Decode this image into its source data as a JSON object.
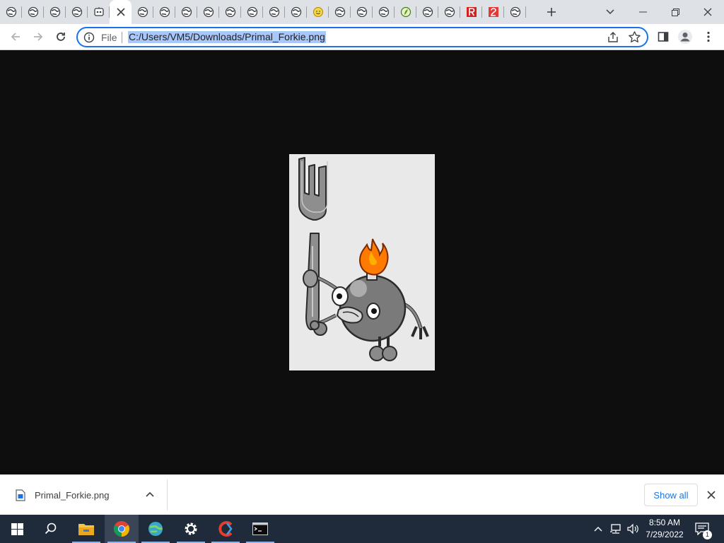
{
  "browser": {
    "tabs": [
      {
        "favicon": "globe-icon",
        "active": false
      },
      {
        "favicon": "globe-icon",
        "active": false
      },
      {
        "favicon": "globe-icon",
        "active": false
      },
      {
        "favicon": "globe-icon",
        "active": false
      },
      {
        "favicon": "robot-icon",
        "active": false
      },
      {
        "favicon": "close-icon",
        "active": true
      },
      {
        "favicon": "globe-icon",
        "active": false
      },
      {
        "favicon": "globe-icon",
        "active": false
      },
      {
        "favicon": "globe-icon",
        "active": false
      },
      {
        "favicon": "globe-icon",
        "active": false
      },
      {
        "favicon": "globe-icon",
        "active": false
      },
      {
        "favicon": "globe-icon",
        "active": false
      },
      {
        "favicon": "globe-icon",
        "active": false
      },
      {
        "favicon": "globe-icon",
        "active": false
      },
      {
        "favicon": "smiley-icon",
        "active": false
      },
      {
        "favicon": "globe-icon",
        "active": false
      },
      {
        "favicon": "globe-icon",
        "active": false
      },
      {
        "favicon": "globe-icon",
        "active": false
      },
      {
        "favicon": "green-leaf-icon",
        "active": false
      },
      {
        "favicon": "globe-icon",
        "active": false
      },
      {
        "favicon": "globe-icon",
        "active": false
      },
      {
        "favicon": "red-r-icon",
        "active": false
      },
      {
        "favicon": "red-2-icon",
        "active": false
      },
      {
        "favicon": "globe-icon",
        "active": false
      }
    ],
    "address_bar": {
      "scheme_label": "File",
      "url": "C:/Users/VM5/Downloads/Primal_Forkie.png"
    },
    "colors": {
      "accent": "#1a73e8",
      "selection": "#a8c7fa",
      "viewer_background": "#0e0e0e",
      "image_background": "#e9e9e9"
    }
  },
  "download_shelf": {
    "file_name": "Primal_Forkie.png",
    "show_all_label": "Show all"
  },
  "taskbar": {
    "apps": [
      "start-icon",
      "search-icon",
      "file-explorer-icon",
      "chrome-icon",
      "globe-app-icon",
      "settings-icon",
      "ccleaner-icon",
      "terminal-icon"
    ],
    "clock": {
      "time": "8:50 AM",
      "date": "7/29/2022"
    },
    "notification_count": "1"
  }
}
